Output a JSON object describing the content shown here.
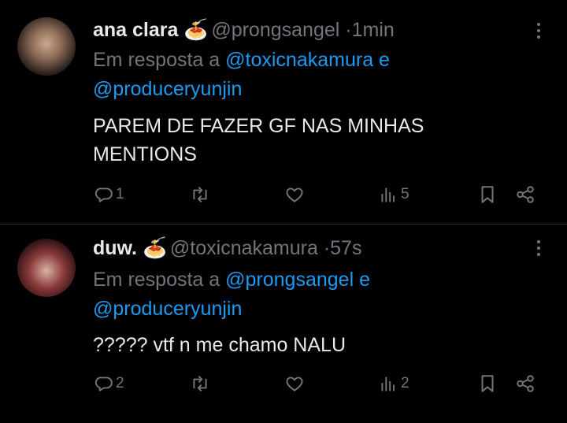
{
  "tweets": [
    {
      "name": "ana clara",
      "emoji": "🍝",
      "handle": "@prongsangel",
      "separator": "·",
      "time": "1min",
      "reply_prefix": "Em resposta a",
      "reply_user1": "@toxicnakamura",
      "reply_conj": "e",
      "reply_user2": "@produceryunjin",
      "text_line1": "PAREM DE FAZER GF NAS MINHAS",
      "text_line2": "MENTIONS",
      "reply_count": "1",
      "view_count": "5"
    },
    {
      "name": "duw.",
      "emoji": "🍝",
      "handle": "@toxicnakamura",
      "separator": "·",
      "time": "57s",
      "reply_prefix": "Em resposta a",
      "reply_user1": "@prongsangel",
      "reply_conj": "e",
      "reply_user2": "@produceryunjin",
      "text_line1": "????? vtf n me chamo NALU",
      "reply_count": "2",
      "view_count": "2"
    }
  ],
  "colors": {
    "background": "#000000",
    "text": "#e7e9ea",
    "muted": "#71767b",
    "link": "#1d9bf0",
    "divider": "#2f3336"
  },
  "icons": [
    "reply-icon",
    "retweet-icon",
    "like-icon",
    "views-icon",
    "bookmark-icon",
    "share-icon",
    "more-icon"
  ]
}
